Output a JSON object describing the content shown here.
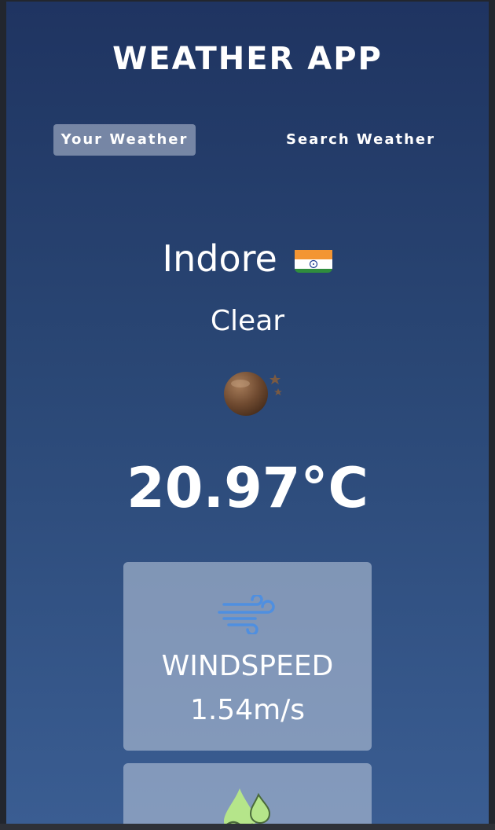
{
  "app": {
    "title": "WEATHER APP"
  },
  "tabs": [
    {
      "label": "Your Weather",
      "active": true
    },
    {
      "label": "Search Weather",
      "active": false
    }
  ],
  "weather": {
    "city": "Indore",
    "country_flag_icon": "india-flag-icon",
    "condition": "Clear",
    "condition_icon": "moon-stars-icon",
    "temperature": "20.97°C"
  },
  "cards": {
    "windspeed": {
      "icon": "wind-icon",
      "label": "WINDSPEED",
      "value": "1.54m/s"
    },
    "humidity": {
      "icon": "humidity-icon"
    }
  },
  "colors": {
    "background_top": "#1f3461",
    "background_bottom": "#3a5d92",
    "card": "#8c9ab5",
    "wind_icon": "#4f8fe0",
    "humidity_icon": "#b5e58a"
  }
}
